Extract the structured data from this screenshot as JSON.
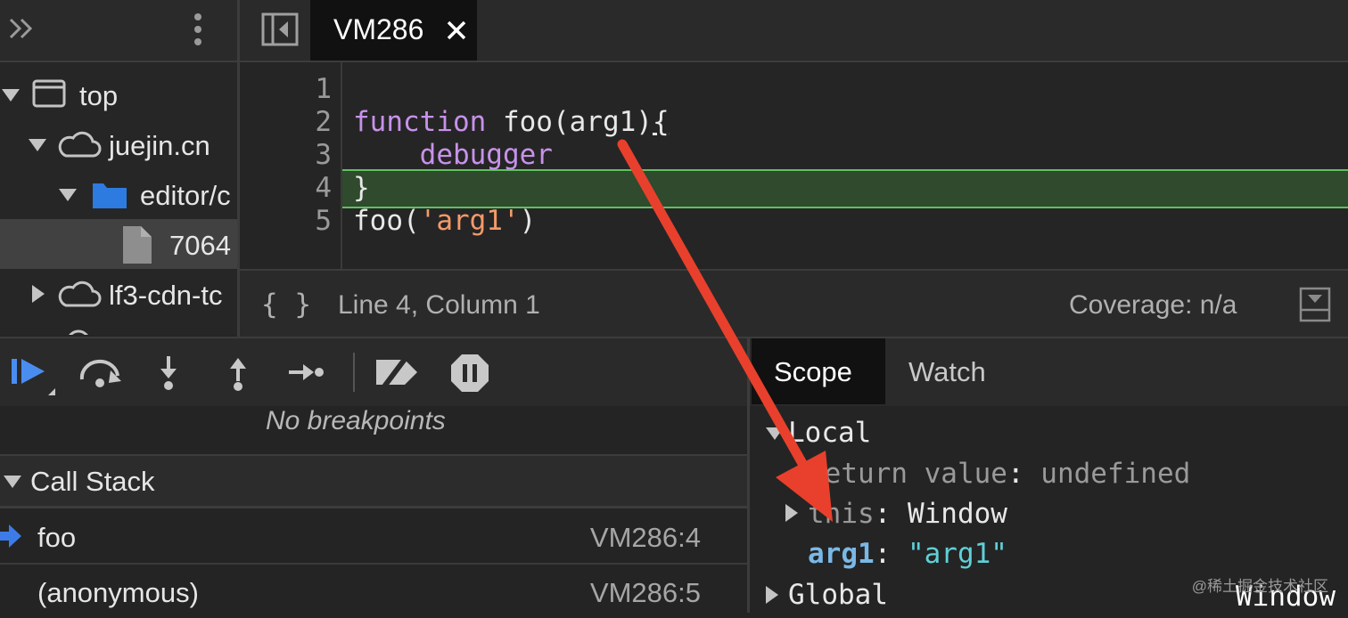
{
  "navigator": {
    "tree": [
      {
        "label": "top"
      },
      {
        "label": "juejin.cn"
      },
      {
        "label": "editor/c"
      },
      {
        "label": "7064"
      },
      {
        "label": "lf3-cdn-tc"
      }
    ]
  },
  "editor": {
    "tab_label": "VM286",
    "lines": [
      {
        "number": "1"
      },
      {
        "number": "2",
        "keyword": "function",
        "rest": " foo(arg1)",
        "brace": "{"
      },
      {
        "number": "3",
        "indent": "    ",
        "statement": "debugger"
      },
      {
        "number": "4",
        "text": "}"
      },
      {
        "number": "5",
        "call": "foo(",
        "string": "'arg1'",
        "close": ")"
      }
    ],
    "status": {
      "format_icon": "{ }",
      "position": "Line 4, Column 1",
      "coverage": "Coverage: n/a"
    }
  },
  "debugger": {
    "breakpoints_empty": "No breakpoints",
    "call_stack": {
      "title": "Call Stack",
      "frames": [
        {
          "name": "foo",
          "location": "VM286:4"
        },
        {
          "name": "(anonymous)",
          "location": "VM286:5"
        }
      ]
    }
  },
  "scope": {
    "tabs": [
      "Scope",
      "Watch"
    ],
    "local": {
      "title": "Local",
      "return_key": "Return value",
      "return_value": "undefined",
      "this_key": "this",
      "this_value": "Window",
      "arg_key": "arg1",
      "arg_value": "\"arg1\""
    },
    "global": {
      "title": "Global",
      "value": "Window"
    }
  },
  "watermark": "@稀土掘金技术社区",
  "colors": {
    "keyword": "#c792ea",
    "string": "#f49a6a",
    "scope_key": "#9a9a9a",
    "arg_key": "#7ab8e6",
    "arg_value": "#5fd0d8",
    "exec_line": "#2f4a2d",
    "annotation_arrow": "#e8402c"
  }
}
